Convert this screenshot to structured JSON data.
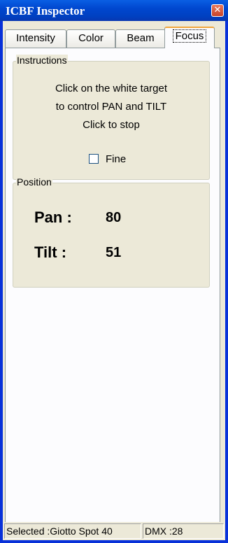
{
  "window": {
    "title": "ICBF Inspector",
    "close_symbol": "✕"
  },
  "tabs": [
    {
      "label": "Intensity"
    },
    {
      "label": "Color"
    },
    {
      "label": "Beam"
    },
    {
      "label": "Focus",
      "active": true
    }
  ],
  "instructions": {
    "legend": "Instructions",
    "lines": [
      "Click on the white target",
      "to control PAN and TILT",
      "Click to stop"
    ],
    "fine_label": "Fine",
    "fine_checked": false
  },
  "position": {
    "legend": "Position",
    "pan_label": "Pan :",
    "pan_value": "80",
    "tilt_label": "Tilt :",
    "tilt_value": "51"
  },
  "status": {
    "selected": "Selected :Giotto Spot 40",
    "dmx": "DMX :28"
  }
}
